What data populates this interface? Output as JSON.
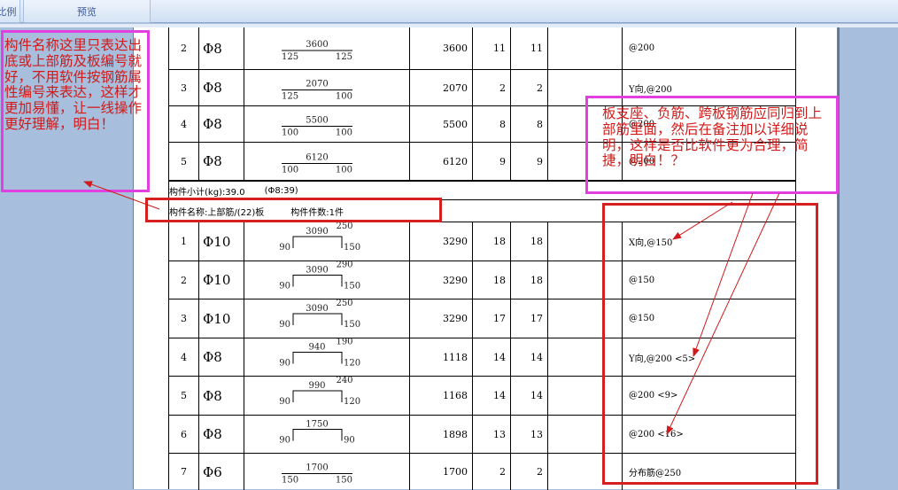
{
  "toolbar": {
    "ratio_label": "比例",
    "preview_label": "预览"
  },
  "table_top": [
    {
      "idx": "2",
      "dia": "Φ8",
      "top": "3600",
      "left": "125",
      "right": "125",
      "length": "3600",
      "count": "11",
      "total": "11",
      "note": "@200"
    },
    {
      "idx": "3",
      "dia": "Φ8",
      "top": "2070",
      "left": "125",
      "right": "100",
      "length": "2070",
      "count": "2",
      "total": "2",
      "note": "Y向,@200"
    },
    {
      "idx": "4",
      "dia": "Φ8",
      "top": "5500",
      "left": "100",
      "right": "100",
      "length": "5500",
      "count": "8",
      "total": "8",
      "note": "@200"
    },
    {
      "idx": "5",
      "dia": "Φ8",
      "top": "6120",
      "left": "100",
      "right": "100",
      "length": "6120",
      "count": "9",
      "total": "9",
      "note": "@200"
    }
  ],
  "subtotal": {
    "label": "构件小计(kg):39.0",
    "detail": "(Φ8:39)"
  },
  "component": {
    "name": "构件名称:上部筋/(22)板",
    "count": "构件件数:1件"
  },
  "table_bottom": [
    {
      "idx": "1",
      "dia": "Φ10",
      "top": "3090",
      "top2": "250",
      "left": "90",
      "right": "150",
      "length": "3290",
      "count": "18",
      "total": "18",
      "note": "X向,@150"
    },
    {
      "idx": "2",
      "dia": "Φ10",
      "top": "3090",
      "top2": "290",
      "left": "90",
      "right": "150",
      "length": "3290",
      "count": "18",
      "total": "18",
      "note": "@150"
    },
    {
      "idx": "3",
      "dia": "Φ10",
      "top": "3090",
      "top2": "250",
      "left": "90",
      "right": "150",
      "length": "3290",
      "count": "17",
      "total": "17",
      "note": "@150"
    },
    {
      "idx": "4",
      "dia": "Φ8",
      "top": "940",
      "top2": "190",
      "left": "90",
      "right": "120",
      "length": "1118",
      "count": "14",
      "total": "14",
      "note": "Y向,@200 <5>"
    },
    {
      "idx": "5",
      "dia": "Φ8",
      "top": "990",
      "top2": "240",
      "left": "90",
      "right": "120",
      "length": "1168",
      "count": "14",
      "total": "14",
      "note": "@200 <9>"
    },
    {
      "idx": "6",
      "dia": "Φ8",
      "top": "1750",
      "top2": "",
      "left": "90",
      "right": "90",
      "length": "1898",
      "count": "13",
      "total": "13",
      "note": "@200 <16>"
    },
    {
      "idx": "7",
      "dia": "Φ6",
      "top": "1700",
      "top2": "",
      "left": "150",
      "right": "150",
      "length": "1700",
      "count": "2",
      "total": "2",
      "note": "分布筋@250"
    }
  ],
  "annotations": {
    "left_note": "构件名称这里只表达出底或上部筋及板编号就好，不用软件按钢筋属性编号来表达，这样才更加易懂，让一线操作更好理解，明白！",
    "right_note": "板支座、负筋、跨板钢筋应同归到上部筋里面，然后在备注加以详细说明，这样是否比软件更为合理，简捷，明白！？"
  },
  "colors": {
    "annotation_red": "#d11a1a",
    "box_magenta": "#e040e0",
    "box_red": "#d42020",
    "page_bg": "#a7bedc"
  }
}
